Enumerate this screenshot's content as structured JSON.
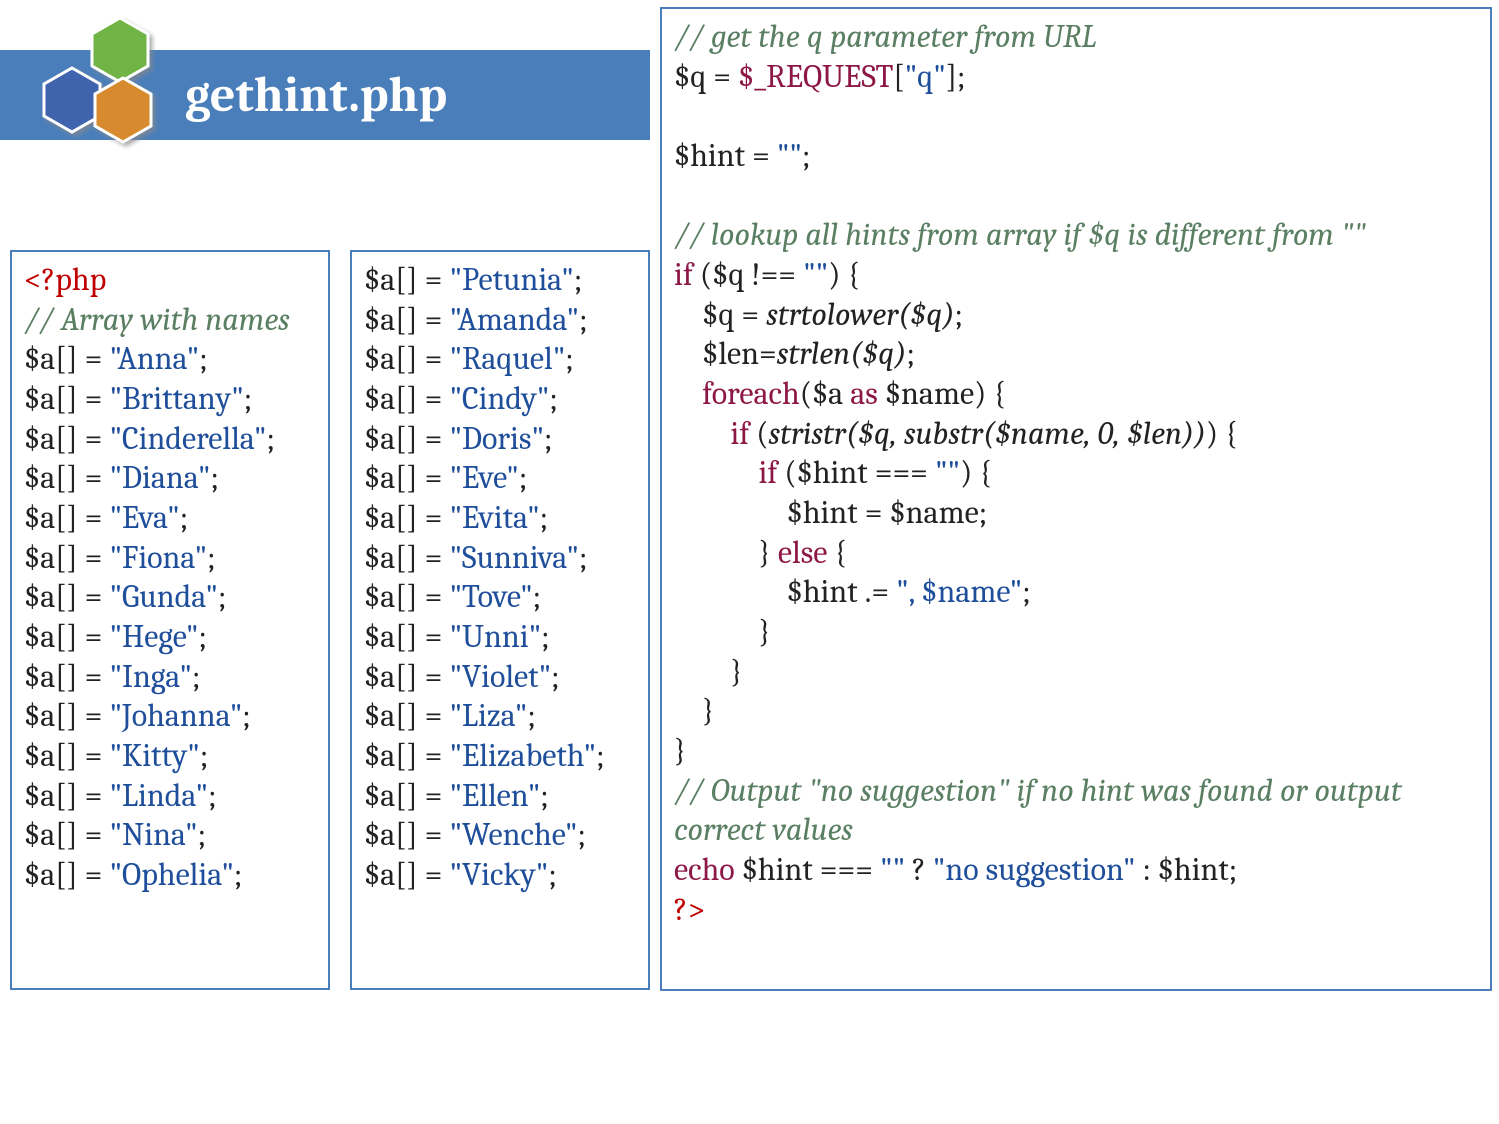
{
  "header": {
    "title": "gethint.php"
  },
  "box1": {
    "lines": [
      [
        {
          "cls": "s-open",
          "t": "<?php"
        }
      ],
      [
        {
          "cls": "s-comment",
          "t": "// Array with names"
        }
      ],
      [
        {
          "cls": "s-plain",
          "t": "$a[] = "
        },
        {
          "cls": "s-str",
          "t": "\"Anna\""
        },
        {
          "cls": "s-plain",
          "t": ";"
        }
      ],
      [
        {
          "cls": "s-plain",
          "t": "$a[] = "
        },
        {
          "cls": "s-str",
          "t": "\"Brittany\""
        },
        {
          "cls": "s-plain",
          "t": ";"
        }
      ],
      [
        {
          "cls": "s-plain",
          "t": "$a[] = "
        },
        {
          "cls": "s-str",
          "t": "\"Cinderella\""
        },
        {
          "cls": "s-plain",
          "t": ";"
        }
      ],
      [
        {
          "cls": "s-plain",
          "t": "$a[] = "
        },
        {
          "cls": "s-str",
          "t": "\"Diana\""
        },
        {
          "cls": "s-plain",
          "t": ";"
        }
      ],
      [
        {
          "cls": "s-plain",
          "t": "$a[] = "
        },
        {
          "cls": "s-str",
          "t": "\"Eva\""
        },
        {
          "cls": "s-plain",
          "t": ";"
        }
      ],
      [
        {
          "cls": "s-plain",
          "t": "$a[] = "
        },
        {
          "cls": "s-str",
          "t": "\"Fiona\""
        },
        {
          "cls": "s-plain",
          "t": ";"
        }
      ],
      [
        {
          "cls": "s-plain",
          "t": "$a[] = "
        },
        {
          "cls": "s-str",
          "t": "\"Gunda\""
        },
        {
          "cls": "s-plain",
          "t": ";"
        }
      ],
      [
        {
          "cls": "s-plain",
          "t": "$a[] = "
        },
        {
          "cls": "s-str",
          "t": "\"Hege\""
        },
        {
          "cls": "s-plain",
          "t": ";"
        }
      ],
      [
        {
          "cls": "s-plain",
          "t": "$a[] = "
        },
        {
          "cls": "s-str",
          "t": "\"Inga\""
        },
        {
          "cls": "s-plain",
          "t": ";"
        }
      ],
      [
        {
          "cls": "s-plain",
          "t": "$a[] = "
        },
        {
          "cls": "s-str",
          "t": "\"Johanna\""
        },
        {
          "cls": "s-plain",
          "t": ";"
        }
      ],
      [
        {
          "cls": "s-plain",
          "t": "$a[] = "
        },
        {
          "cls": "s-str",
          "t": "\"Kitty\""
        },
        {
          "cls": "s-plain",
          "t": ";"
        }
      ],
      [
        {
          "cls": "s-plain",
          "t": "$a[] = "
        },
        {
          "cls": "s-str",
          "t": "\"Linda\""
        },
        {
          "cls": "s-plain",
          "t": ";"
        }
      ],
      [
        {
          "cls": "s-plain",
          "t": "$a[] = "
        },
        {
          "cls": "s-str",
          "t": "\"Nina\""
        },
        {
          "cls": "s-plain",
          "t": ";"
        }
      ],
      [
        {
          "cls": "s-plain",
          "t": "$a[] = "
        },
        {
          "cls": "s-str",
          "t": "\"Ophelia\""
        },
        {
          "cls": "s-plain",
          "t": ";"
        }
      ]
    ]
  },
  "box2": {
    "lines": [
      [
        {
          "cls": "s-plain",
          "t": "$a[] = "
        },
        {
          "cls": "s-str",
          "t": "\"Petunia\""
        },
        {
          "cls": "s-plain",
          "t": ";"
        }
      ],
      [
        {
          "cls": "s-plain",
          "t": "$a[] = "
        },
        {
          "cls": "s-str",
          "t": "\"Amanda\""
        },
        {
          "cls": "s-plain",
          "t": ";"
        }
      ],
      [
        {
          "cls": "s-plain",
          "t": "$a[] = "
        },
        {
          "cls": "s-str",
          "t": "\"Raquel\""
        },
        {
          "cls": "s-plain",
          "t": ";"
        }
      ],
      [
        {
          "cls": "s-plain",
          "t": "$a[] = "
        },
        {
          "cls": "s-str",
          "t": "\"Cindy\""
        },
        {
          "cls": "s-plain",
          "t": ";"
        }
      ],
      [
        {
          "cls": "s-plain",
          "t": "$a[] = "
        },
        {
          "cls": "s-str",
          "t": "\"Doris\""
        },
        {
          "cls": "s-plain",
          "t": ";"
        }
      ],
      [
        {
          "cls": "s-plain",
          "t": "$a[] = "
        },
        {
          "cls": "s-str",
          "t": "\"Eve\""
        },
        {
          "cls": "s-plain",
          "t": ";"
        }
      ],
      [
        {
          "cls": "s-plain",
          "t": "$a[] = "
        },
        {
          "cls": "s-str",
          "t": "\"Evita\""
        },
        {
          "cls": "s-plain",
          "t": ";"
        }
      ],
      [
        {
          "cls": "s-plain",
          "t": "$a[] = "
        },
        {
          "cls": "s-str",
          "t": "\"Sunniva\""
        },
        {
          "cls": "s-plain",
          "t": ";"
        }
      ],
      [
        {
          "cls": "s-plain",
          "t": "$a[] = "
        },
        {
          "cls": "s-str",
          "t": "\"Tove\""
        },
        {
          "cls": "s-plain",
          "t": ";"
        }
      ],
      [
        {
          "cls": "s-plain",
          "t": "$a[] = "
        },
        {
          "cls": "s-str",
          "t": "\"Unni\""
        },
        {
          "cls": "s-plain",
          "t": ";"
        }
      ],
      [
        {
          "cls": "s-plain",
          "t": "$a[] = "
        },
        {
          "cls": "s-str",
          "t": "\"Violet\""
        },
        {
          "cls": "s-plain",
          "t": ";"
        }
      ],
      [
        {
          "cls": "s-plain",
          "t": "$a[] = "
        },
        {
          "cls": "s-str",
          "t": "\"Liza\""
        },
        {
          "cls": "s-plain",
          "t": ";"
        }
      ],
      [
        {
          "cls": "s-plain",
          "t": "$a[] = "
        },
        {
          "cls": "s-str",
          "t": "\"Elizabeth\""
        },
        {
          "cls": "s-plain",
          "t": ";"
        }
      ],
      [
        {
          "cls": "s-plain",
          "t": "$a[] = "
        },
        {
          "cls": "s-str",
          "t": "\"Ellen\""
        },
        {
          "cls": "s-plain",
          "t": ";"
        }
      ],
      [
        {
          "cls": "s-plain",
          "t": "$a[] = "
        },
        {
          "cls": "s-str",
          "t": "\"Wenche\""
        },
        {
          "cls": "s-plain",
          "t": ";"
        }
      ],
      [
        {
          "cls": "s-plain",
          "t": "$a[] = "
        },
        {
          "cls": "s-str",
          "t": "\"Vicky\""
        },
        {
          "cls": "s-plain",
          "t": ";"
        }
      ]
    ]
  },
  "box3": {
    "lines": [
      [
        {
          "cls": "s-comment",
          "t": "// get the q parameter from URL"
        }
      ],
      [
        {
          "cls": "s-plain",
          "t": "$q = "
        },
        {
          "cls": "s-kw",
          "t": "$_REQUEST"
        },
        {
          "cls": "s-plain",
          "t": "["
        },
        {
          "cls": "s-str",
          "t": "\"q\""
        },
        {
          "cls": "s-plain",
          "t": "];"
        }
      ],
      [
        {
          "cls": "s-plain",
          "t": " "
        }
      ],
      [
        {
          "cls": "s-plain",
          "t": "$hint = "
        },
        {
          "cls": "s-str",
          "t": "\"\""
        },
        {
          "cls": "s-plain",
          "t": ";"
        }
      ],
      [
        {
          "cls": "s-plain",
          "t": " "
        }
      ],
      [
        {
          "cls": "s-comment",
          "t": "// lookup all hints from array if $q is different from \"\""
        }
      ],
      [
        {
          "cls": "s-kw",
          "t": "if"
        },
        {
          "cls": "s-plain",
          "t": " ($q !== "
        },
        {
          "cls": "s-str",
          "t": "\"\""
        },
        {
          "cls": "s-plain",
          "t": ") {"
        }
      ],
      [
        {
          "cls": "s-plain",
          "t": "    $q = "
        },
        {
          "cls": "s-func",
          "t": "strtolower($q)"
        },
        {
          "cls": "s-plain",
          "t": ";"
        }
      ],
      [
        {
          "cls": "s-plain",
          "t": "    $len="
        },
        {
          "cls": "s-func",
          "t": "strlen($q)"
        },
        {
          "cls": "s-plain",
          "t": ";"
        }
      ],
      [
        {
          "cls": "s-plain",
          "t": "    "
        },
        {
          "cls": "s-kw",
          "t": "foreach"
        },
        {
          "cls": "s-plain",
          "t": "($a "
        },
        {
          "cls": "s-kw",
          "t": "as"
        },
        {
          "cls": "s-plain",
          "t": " $name) {"
        }
      ],
      [
        {
          "cls": "s-plain",
          "t": "        "
        },
        {
          "cls": "s-kw",
          "t": "if"
        },
        {
          "cls": "s-plain",
          "t": " ("
        },
        {
          "cls": "s-func",
          "t": "stristr($q, substr($name, 0, $len))"
        },
        {
          "cls": "s-plain",
          "t": ") {"
        }
      ],
      [
        {
          "cls": "s-plain",
          "t": "            "
        },
        {
          "cls": "s-kw",
          "t": "if"
        },
        {
          "cls": "s-plain",
          "t": " ($hint === "
        },
        {
          "cls": "s-str",
          "t": "\"\""
        },
        {
          "cls": "s-plain",
          "t": ") {"
        }
      ],
      [
        {
          "cls": "s-plain",
          "t": "                $hint = $name;"
        }
      ],
      [
        {
          "cls": "s-plain",
          "t": "            } "
        },
        {
          "cls": "s-kw",
          "t": "else"
        },
        {
          "cls": "s-plain",
          "t": " {"
        }
      ],
      [
        {
          "cls": "s-plain",
          "t": "                $hint .= "
        },
        {
          "cls": "s-str",
          "t": "\", $name\""
        },
        {
          "cls": "s-plain",
          "t": ";"
        }
      ],
      [
        {
          "cls": "s-plain",
          "t": "            }"
        }
      ],
      [
        {
          "cls": "s-plain",
          "t": "        }"
        }
      ],
      [
        {
          "cls": "s-plain",
          "t": "    }"
        }
      ],
      [
        {
          "cls": "s-plain",
          "t": "}"
        }
      ],
      [
        {
          "cls": "s-comment",
          "t": "// Output \"no suggestion\" if no hint was found or output correct values"
        }
      ],
      [
        {
          "cls": "s-kw",
          "t": "echo"
        },
        {
          "cls": "s-plain",
          "t": " $hint === "
        },
        {
          "cls": "s-str",
          "t": "\"\""
        },
        {
          "cls": "s-plain",
          "t": " ? "
        },
        {
          "cls": "s-str",
          "t": "\"no suggestion\""
        },
        {
          "cls": "s-plain",
          "t": " : $hint;"
        }
      ],
      [
        {
          "cls": "s-open",
          "t": "?>"
        }
      ]
    ]
  }
}
